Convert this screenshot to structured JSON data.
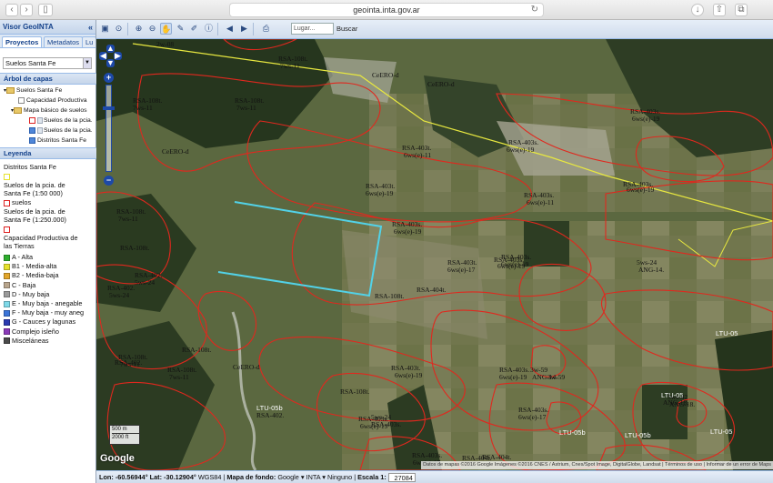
{
  "browser": {
    "url": "geointa.inta.gov.ar"
  },
  "panel": {
    "title": "Visor GeoINTA",
    "tabs": [
      "Proyectos",
      "Metadatos",
      "Lu"
    ],
    "project_select": "Suelos Santa Fe"
  },
  "tree": {
    "title": "Árbol de capas",
    "items": [
      "Suelos Santa Fe",
      "Capacidad Productiva",
      "Mapa básico de suelos",
      "Suelos de la pcia.",
      "Suelos de la pcia.",
      "Distritos Santa Fe"
    ]
  },
  "legend": {
    "title": "Leyenda",
    "group1": "Distritos Santa Fe",
    "group2_line1": "Suelos de la pcia. de",
    "group2_line2": "Santa Fe (1:50 000)",
    "group2_item": "suelos",
    "group3_line1": "Suelos de la pcia. de",
    "group3_line2": "Santa Fe (1:250.000)",
    "group4_line1": "Capacidad Productiva de",
    "group4_line2": "las Tierras",
    "classes": [
      {
        "label": "A - Alta",
        "color": "#2eae2e"
      },
      {
        "label": "B1 - Media-alta",
        "color": "#e6e22e"
      },
      {
        "label": "B2 - Media-baja",
        "color": "#e2a62a"
      },
      {
        "label": "C - Baja",
        "color": "#b8a58c"
      },
      {
        "label": "D - Muy baja",
        "color": "#9a9a9a"
      },
      {
        "label": "E - Muy baja - anegable",
        "color": "#7fd9e8"
      },
      {
        "label": "F - Muy baja - muy aneg",
        "color": "#3a74d8"
      },
      {
        "label": "G - Cauces y lagunas",
        "color": "#2a3ab0"
      },
      {
        "label": "Complejo isleño",
        "color": "#8a3ab8"
      },
      {
        "label": "Misceláneas",
        "color": "#4a4a4a"
      }
    ]
  },
  "toolbar": {
    "place_placeholder": "Lugar...",
    "search_label": "Buscar"
  },
  "map": {
    "scale_m": "500 m",
    "scale_ft": "2000 ft",
    "provider": "Google",
    "attribution": "Datos de mapas ©2016 Google Imágenes ©2016 CNES / Astrium, Cnes/Spot Image, DigitalGlobe, Landsat  |  Términos de uso  |  Informar de un error de Maps",
    "labels": [
      "2w-08",
      "RSA-108t.",
      "7ws-11",
      "CeERO-d",
      "CeERO-d",
      "RSA-108t.",
      "7ws-11",
      "RSA-108t.",
      "7ws-11",
      "CeERO-d",
      "RSA-403t.",
      "6ws(e)-11",
      "RSA-403t.",
      "6ws(e)-19",
      "RSA-403s.",
      "6ws(e)-19",
      "RSA-403s.",
      "6ws(e)-19",
      "RSA-403s.",
      "6ws(e)-19",
      "RSA-403s.",
      "6ws(e)-11",
      "RSA-108t.",
      "7ws-11",
      "RSA-108t.",
      "RSA-402.",
      "5ws-24",
      "RSA-402.",
      "5ws-24",
      "RSA-108t.",
      "7ws-11",
      "RSA-108t.",
      "7ws-11",
      "RSA-108t.",
      "CeERO-d",
      "RSA-403t.",
      "6ws(e)-17",
      "RSA-404t.",
      "RSA-403t.",
      "6ws(e)-19",
      "RSA-403s.",
      "6ws(e)-19",
      "RSA-403s.",
      "6ws(e)-19",
      "RSA-108t.",
      "RSA-403s.",
      "6ws(e)-19",
      "RSA-403s.",
      "6ws(e)-17",
      "RSA-108t.",
      "RSA-403s.",
      "6ws(e)-19",
      "RSA-404t.",
      "RSA-404t.",
      "RSA-403s.",
      "6ws(e)-17",
      "RSA-403s.",
      "6ws(e)-19",
      "RSA-402.",
      "5ws-24",
      "ANG-14.",
      "3w-59",
      "ANG-14.",
      "3w-59",
      "LTU-05b",
      "LTU-05",
      "LTU-05",
      "LTU-05b",
      "LTU-05",
      "ANG-18.",
      "5ws-42",
      "ANG-18.",
      "5ws-42",
      "LTU-05b",
      "RSA-402.",
      "5ws-24",
      "RSA-403s.",
      "6ws(e)-19"
    ]
  },
  "status": {
    "lon": "Lon: -60.56944°",
    "lat": "Lat: -30.12904°",
    "crs": "WGS84",
    "basemap_label": "Mapa de fondo:",
    "basemap_value": "Google",
    "layer2": "INTA",
    "layer3": "Ninguno",
    "scale_label": "Escala 1:",
    "scale_value": "27084"
  }
}
